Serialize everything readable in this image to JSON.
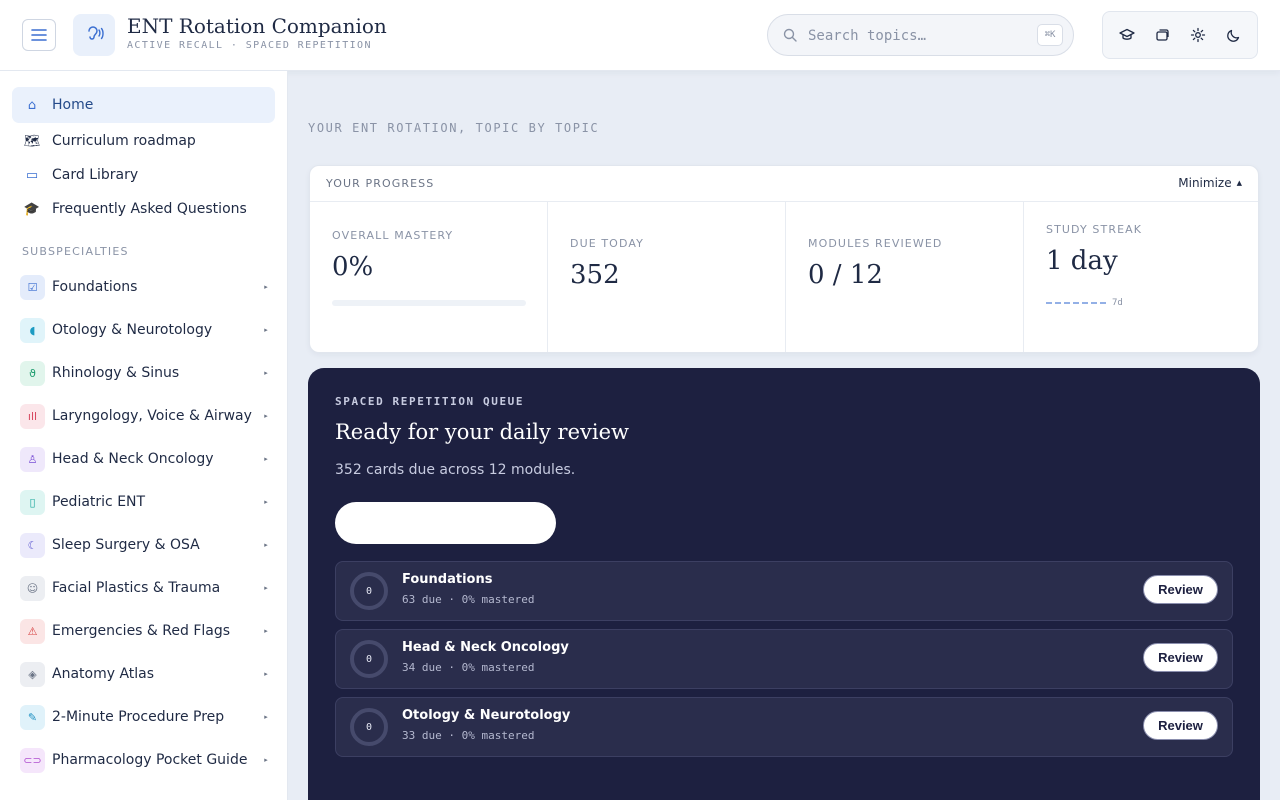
{
  "header": {
    "title": "ENT Rotation Companion",
    "subtitle": "ACTIVE RECALL · SPACED REPETITION",
    "search_placeholder": "Search topics…",
    "search_shortcut": "⌘K",
    "toolbar": [
      "graduation-cap-icon",
      "cards-icon",
      "gear-icon",
      "moon-icon"
    ]
  },
  "sidebar": {
    "nav": [
      {
        "label": "Home",
        "icon": "home-icon",
        "glyph": "⌂"
      },
      {
        "label": "Curriculum roadmap",
        "icon": "map-icon",
        "glyph": "🗺"
      },
      {
        "label": "Card Library",
        "icon": "card-icon",
        "glyph": "▭"
      },
      {
        "label": "Frequently Asked Questions",
        "icon": "grad-cap-icon",
        "glyph": "🎓"
      }
    ],
    "section_label": "SUBSPECIALTIES",
    "subspecialties": [
      {
        "label": "Foundations",
        "color": "#3b6fd1",
        "bg": "#e4ecfb",
        "glyph": "☑"
      },
      {
        "label": "Otology & Neurotology",
        "color": "#1c9bc2",
        "bg": "#e0f4fa",
        "glyph": "◖"
      },
      {
        "label": "Rhinology & Sinus",
        "color": "#1a9b6c",
        "bg": "#e1f5ec",
        "glyph": "ϑ"
      },
      {
        "label": "Laryngology, Voice & Airway",
        "color": "#d6455d",
        "bg": "#fbe6ea",
        "glyph": "ıll"
      },
      {
        "label": "Head & Neck Oncology",
        "color": "#7a4fd6",
        "bg": "#efe8fb",
        "glyph": "♙"
      },
      {
        "label": "Pediatric ENT",
        "color": "#1aa79c",
        "bg": "#def5f2",
        "glyph": "▯"
      },
      {
        "label": "Sleep Surgery & OSA",
        "color": "#5a56d0",
        "bg": "#ebeafb",
        "glyph": "☾"
      },
      {
        "label": "Facial Plastics & Trauma",
        "color": "#6b7486",
        "bg": "#eceef2",
        "glyph": "☺"
      },
      {
        "label": "Emergencies & Red Flags",
        "color": "#d63f3f",
        "bg": "#fbe5e5",
        "glyph": "⚠"
      },
      {
        "label": "Anatomy Atlas",
        "color": "#6b7486",
        "bg": "#eceef2",
        "glyph": "◈"
      },
      {
        "label": "2-Minute Procedure Prep",
        "color": "#1c8fc2",
        "bg": "#e0f2fa",
        "glyph": "✎"
      },
      {
        "label": "Pharmacology Pocket Guide",
        "color": "#b04fcf",
        "bg": "#f5e6fb",
        "glyph": "⊂⊃"
      }
    ]
  },
  "main": {
    "heading": "YOUR ENT ROTATION, TOPIC BY TOPIC",
    "progress": {
      "title": "YOUR PROGRESS",
      "minimize_label": "Minimize",
      "overall_mastery_label": "OVERALL MASTERY",
      "overall_mastery_value": "0%",
      "overall_mastery_fraction": 0,
      "due_today_label": "DUE TODAY",
      "due_today_value": "352",
      "modules_reviewed_label": "MODULES REVIEWED",
      "modules_reviewed_value": "0 / 12",
      "study_streak_label": "STUDY STREAK",
      "study_streak_value": "1 day",
      "streak_window": "7d"
    },
    "queue": {
      "eyebrow": "SPACED REPETITION QUEUE",
      "title": "Ready for your daily review",
      "subtitle": "352 cards due across 12 modules.",
      "start_label": "",
      "rows": [
        {
          "ring": "0",
          "name": "Foundations",
          "meta": "63 due · 0% mastered",
          "action": "Review"
        },
        {
          "ring": "0",
          "name": "Head & Neck Oncology",
          "meta": "34 due · 0% mastered",
          "action": "Review"
        },
        {
          "ring": "0",
          "name": "Otology & Neurotology",
          "meta": "33 due · 0% mastered",
          "action": "Review"
        }
      ]
    }
  }
}
